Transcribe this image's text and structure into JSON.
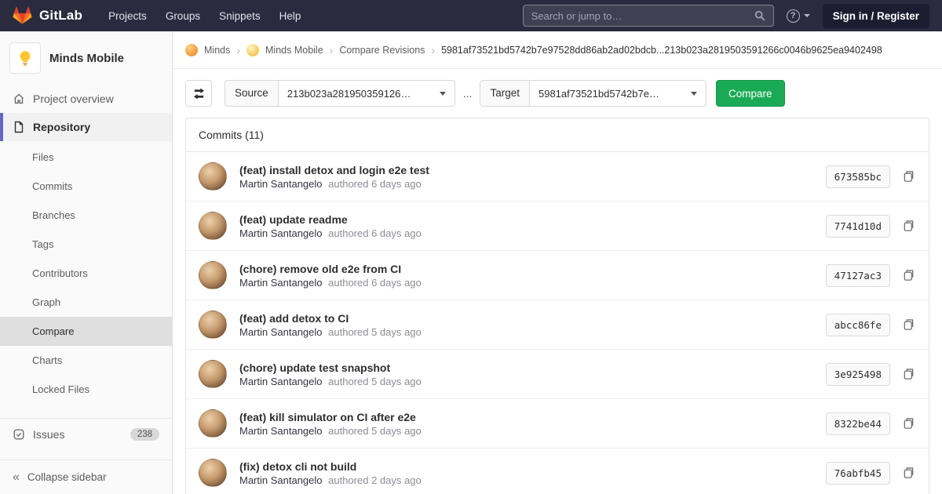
{
  "colors": {
    "navbar_bg": "#2b2b3f",
    "sidebar_active_indicator": "#6666c4",
    "compare_button_green": "#1aaa55",
    "sidebar_bg": "#fafafa"
  },
  "icons": {
    "question_mark": "?",
    "collapse_glyph": "«",
    "breadcrumb_separator": "›"
  },
  "navbar": {
    "logo_text": "GitLab",
    "menu": [
      "Projects",
      "Groups",
      "Snippets",
      "Help"
    ],
    "search": {
      "placeholder": "Search or jump to…"
    },
    "sign_in_label": "Sign in / Register"
  },
  "sidebar": {
    "project_name": "Minds Mobile",
    "overview_label": "Project overview",
    "repository_label": "Repository",
    "repository_items": [
      "Files",
      "Commits",
      "Branches",
      "Tags",
      "Contributors",
      "Graph",
      "Compare",
      "Charts",
      "Locked Files"
    ],
    "active_item": "Compare",
    "issues_label": "Issues",
    "issues_count": "238",
    "collapse_label": "Collapse sidebar"
  },
  "breadcrumb": {
    "group": "Minds",
    "project": "Minds Mobile",
    "page": "Compare Revisions",
    "revisions": "5981af73521bd5742b7e97528dd86ab2ad02bdcb...213b023a2819503591266c0046b9625ea9402498"
  },
  "compare_form": {
    "source_label": "Source",
    "source_value": "213b023a281950359126…",
    "separator": "...",
    "target_label": "Target",
    "target_value": "5981af73521bd5742b7e…",
    "compare_button_label": "Compare"
  },
  "commits": {
    "header": "Commits (11)",
    "items": [
      {
        "title": "(feat) install detox and login e2e test",
        "author": "Martin Santangelo",
        "meta": "authored 6 days ago",
        "sha": "673585bc"
      },
      {
        "title": "(feat) update readme",
        "author": "Martin Santangelo",
        "meta": "authored 6 days ago",
        "sha": "7741d10d"
      },
      {
        "title": "(chore) remove old e2e from CI",
        "author": "Martin Santangelo",
        "meta": "authored 6 days ago",
        "sha": "47127ac3"
      },
      {
        "title": "(feat) add detox to CI",
        "author": "Martin Santangelo",
        "meta": "authored 5 days ago",
        "sha": "abcc86fe"
      },
      {
        "title": "(chore) update test snapshot",
        "author": "Martin Santangelo",
        "meta": "authored 5 days ago",
        "sha": "3e925498"
      },
      {
        "title": "(feat) kill simulator on CI after e2e",
        "author": "Martin Santangelo",
        "meta": "authored 5 days ago",
        "sha": "8322be44"
      },
      {
        "title": "(fix) detox cli not build",
        "author": "Martin Santangelo",
        "meta": "authored 2 days ago",
        "sha": "76abfb45"
      }
    ]
  }
}
